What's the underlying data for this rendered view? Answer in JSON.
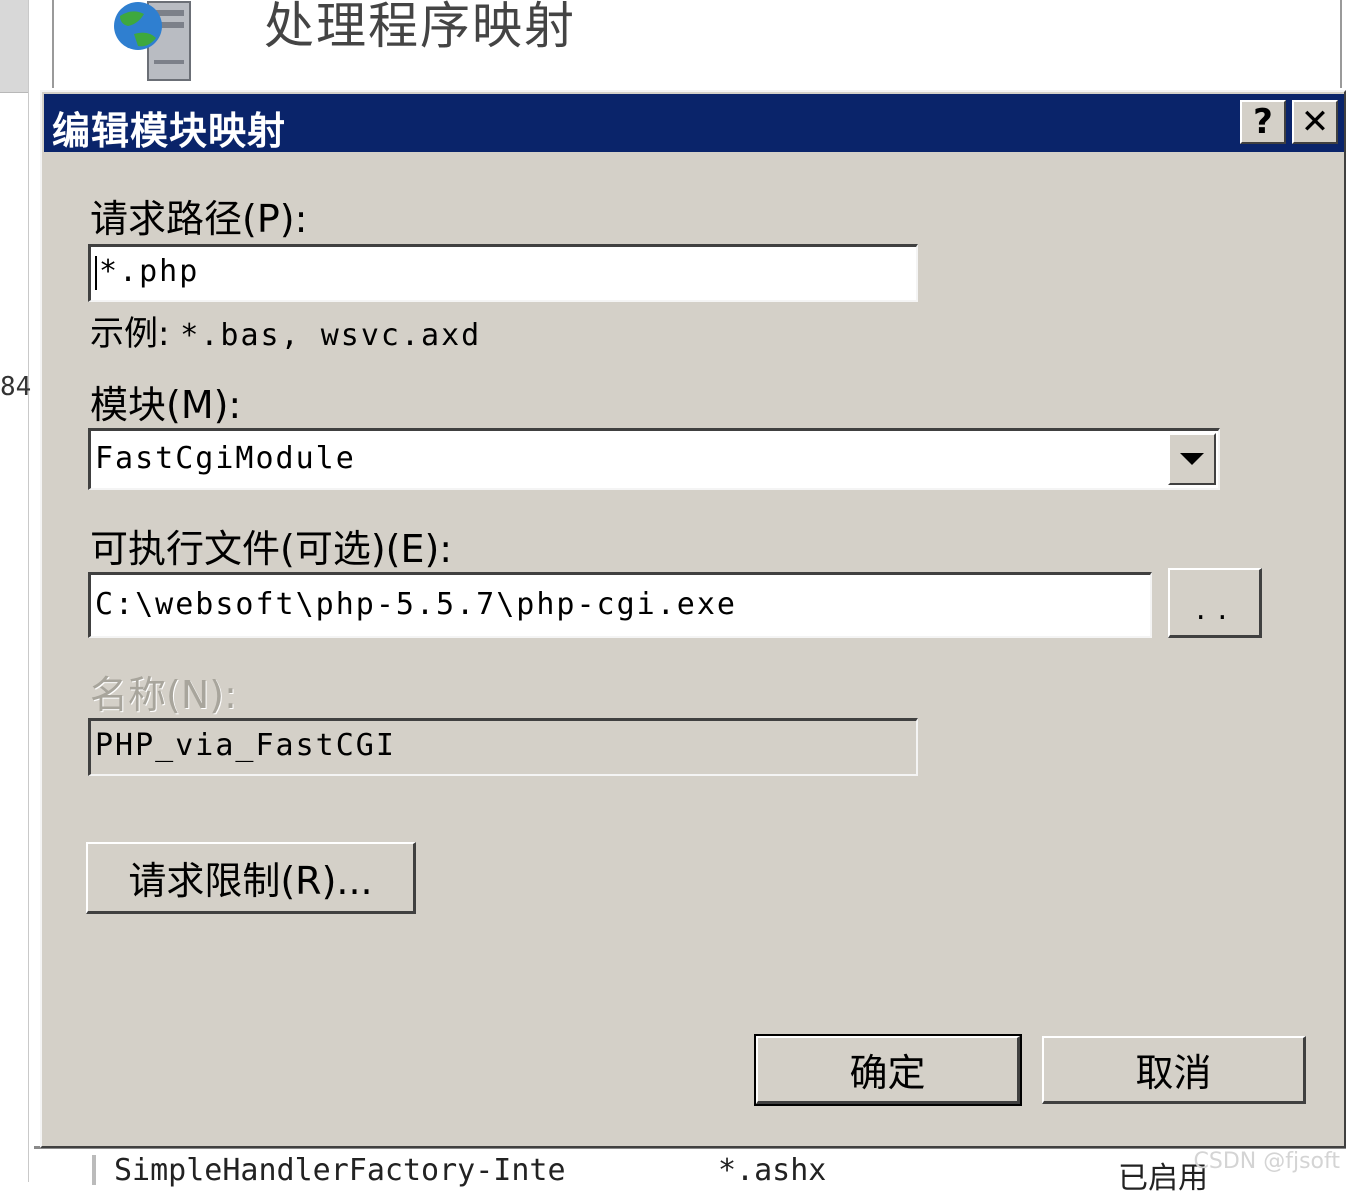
{
  "background": {
    "window_title": "处理程序映射",
    "side_number": "84",
    "bottom_row": {
      "name": "SimpleHandlerFactory-Inte",
      "path": "*.ashx",
      "state": "已启用"
    },
    "watermark": "CSDN @fjsoft"
  },
  "dialog": {
    "title": "编辑模块映射",
    "help_button": "?",
    "close_button": "✕",
    "request_path": {
      "label": "请求路径(P):",
      "value": "*.php",
      "example_label": "示例:",
      "example_value": "*.bas, wsvc.axd"
    },
    "module": {
      "label": "模块(M):",
      "value": "FastCgiModule"
    },
    "executable": {
      "label": "可执行文件(可选)(E):",
      "value": "C:\\websoft\\php-5.5.7\\php-cgi.exe",
      "browse_label": ".."
    },
    "name": {
      "label": "名称(N):",
      "value": "PHP_via_FastCGI"
    },
    "request_restrictions_label": "请求限制(R)...",
    "ok_label": "确定",
    "cancel_label": "取消"
  }
}
